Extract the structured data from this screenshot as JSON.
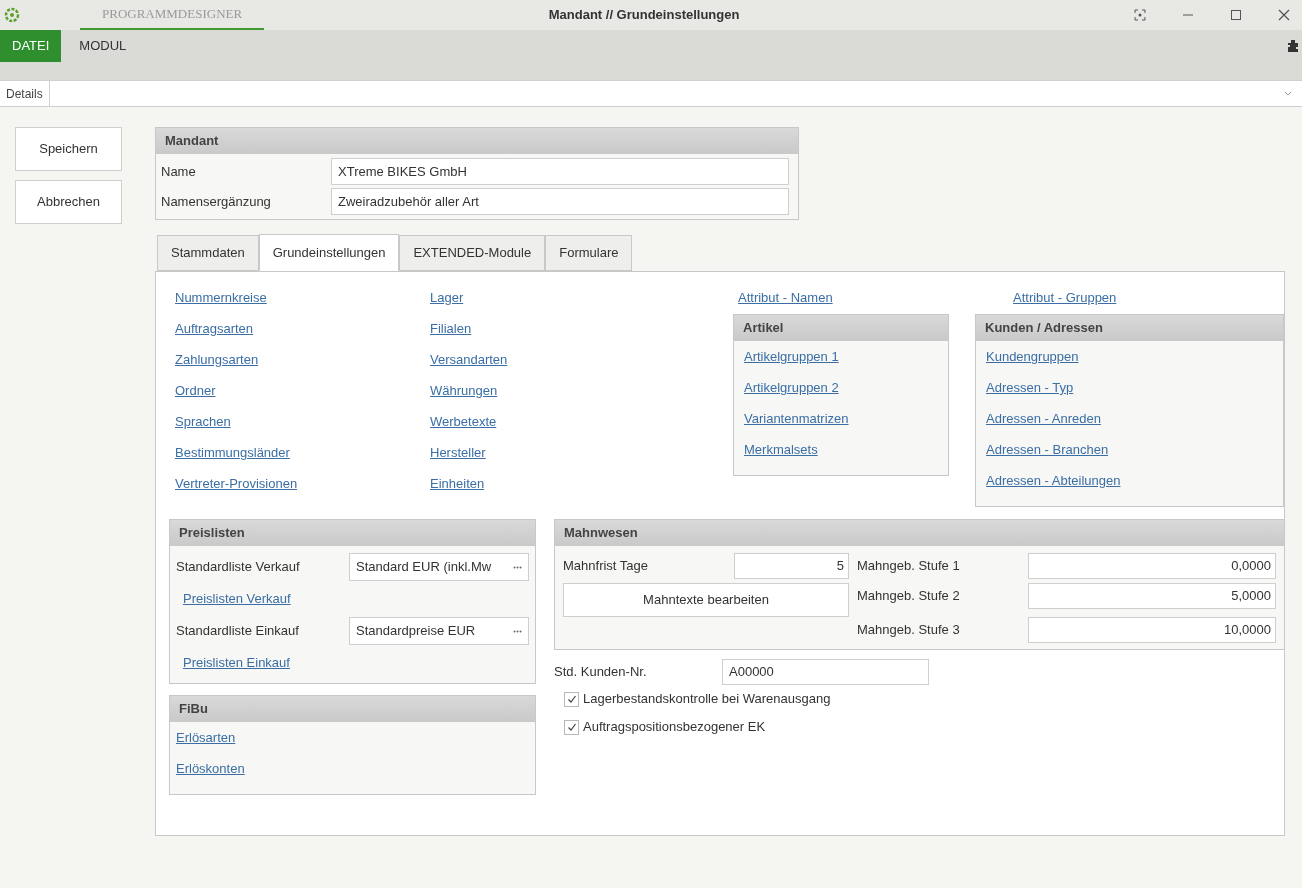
{
  "app": {
    "title": "PROGRAMMDESIGNER",
    "window_title": "Mandant // Grundeinstellungen"
  },
  "menu": [
    {
      "label": "DATEI",
      "selected": true
    },
    {
      "label": "MODUL",
      "selected": false
    }
  ],
  "view_tab": {
    "label": "Details"
  },
  "actions": [
    "Speichern",
    "Abbrechen"
  ],
  "mandant": {
    "title": "Mandant",
    "fields": [
      {
        "label": "Name",
        "value": "XTreme BIKES GmbH"
      },
      {
        "label": "Namensergänzung",
        "value": "Zweiradzubehör aller Art"
      }
    ]
  },
  "tabs": [
    {
      "label": "Stammdaten",
      "selected": false
    },
    {
      "label": "Grundeinstellungen",
      "selected": true
    },
    {
      "label": "EXTENDED-Module",
      "selected": false
    },
    {
      "label": "Formulare",
      "selected": false
    }
  ],
  "links_col1": [
    "Nummernkreise",
    "Auftragsarten",
    "Zahlungsarten",
    "Ordner",
    "Sprachen",
    "Bestimmungsländer",
    "Vertreter-Provisionen"
  ],
  "links_col2": [
    "Lager",
    "Filialen",
    "Versandarten",
    "Währungen",
    "Werbetexte",
    "Hersteller",
    "Einheiten"
  ],
  "attribute_links": [
    "Attribut - Namen",
    "Attribut - Gruppen"
  ],
  "artikel": {
    "title": "Artikel",
    "links": [
      "Artikelgruppen 1",
      "Artikelgruppen 2",
      "Variantenmatrizen",
      "Merkmalsets"
    ]
  },
  "kunden": {
    "title": "Kunden / Adressen",
    "links": [
      "Kundengruppen",
      "Adressen - Typ",
      "Adressen - Anreden",
      "Adressen - Branchen",
      "Adressen - Abteilungen"
    ]
  },
  "preislisten": {
    "title": "Preislisten",
    "rows": [
      {
        "kind": "select",
        "label": "Standardliste Verkauf",
        "value": "Standard EUR (inkl.Mw"
      },
      {
        "kind": "link",
        "label": "Preislisten Verkauf"
      },
      {
        "kind": "select",
        "label": "Standardliste Einkauf",
        "value": "Standardpreise EUR"
      },
      {
        "kind": "link",
        "label": "Preislisten Einkauf"
      }
    ]
  },
  "fibu": {
    "title": "FiBu",
    "links": [
      "Erlösarten",
      "Erlöskonten"
    ]
  },
  "mahnwesen": {
    "title": "Mahnwesen",
    "mahnfrist": {
      "label": "Mahnfrist Tage",
      "value": "5"
    },
    "button": "Mahntexte bearbeiten",
    "stufen": [
      {
        "label": "Mahngeb. Stufe 1",
        "value": "0,0000"
      },
      {
        "label": "Mahngeb. Stufe 2",
        "value": "5,0000"
      },
      {
        "label": "Mahngeb. Stufe 3",
        "value": "10,0000"
      }
    ]
  },
  "kunden_nr": {
    "label": "Std. Kunden-Nr.",
    "value": "A00000"
  },
  "options": [
    {
      "label": "Lagerbestandskontrolle bei Warenausgang",
      "checked": true
    },
    {
      "label": "Auftragspositionsbezogener EK",
      "checked": true
    }
  ]
}
